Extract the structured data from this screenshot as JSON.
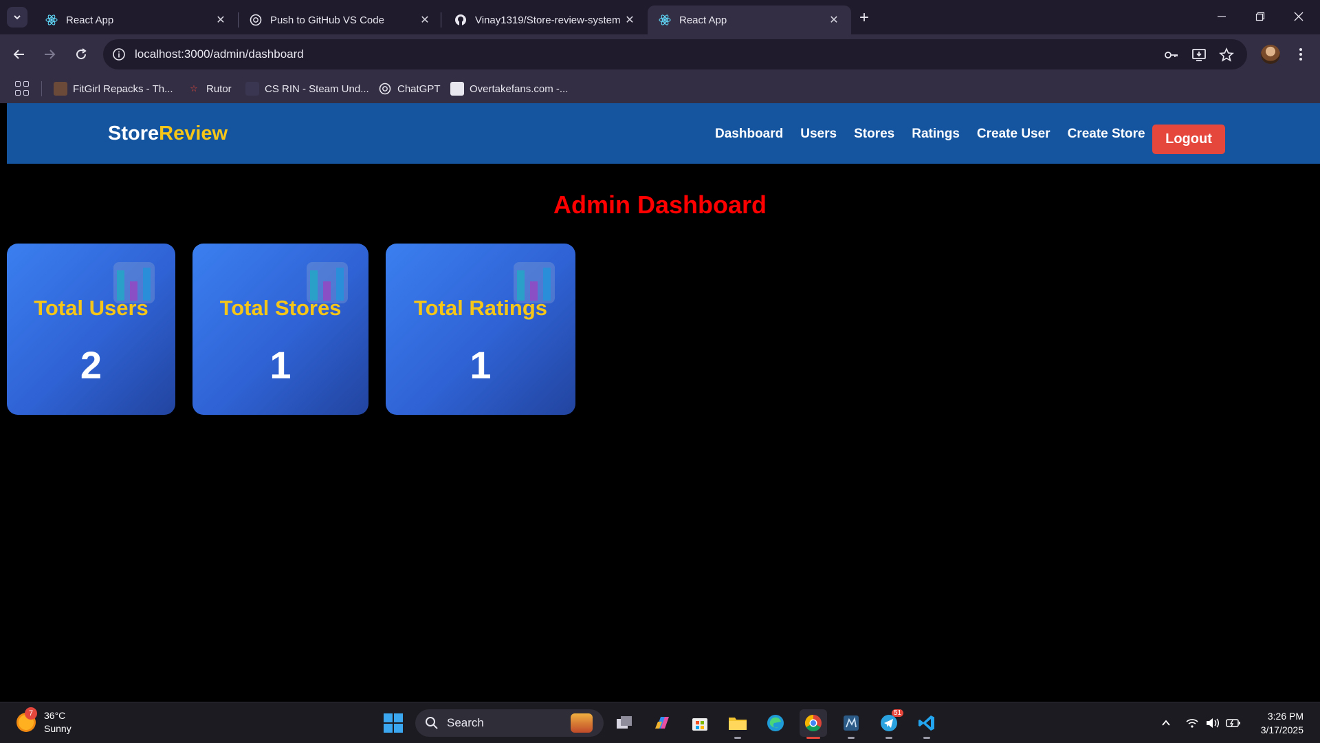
{
  "browser": {
    "tabs": [
      {
        "title": "React App",
        "icon": "react-icon",
        "active": false
      },
      {
        "title": "Push to GitHub VS Code",
        "icon": "chatgpt-icon",
        "active": false
      },
      {
        "title": "Vinay1319/Store-review-system",
        "icon": "github-icon",
        "active": false
      },
      {
        "title": "React App",
        "icon": "react-icon",
        "active": true
      }
    ],
    "url": "localhost:3000/admin/dashboard",
    "bookmarks": [
      {
        "label": "FitGirl Repacks - Th...",
        "icon": "fitgirl-icon"
      },
      {
        "label": "Rutor",
        "icon": "rutor-icon"
      },
      {
        "label": "CS RIN - Steam Und...",
        "icon": "csrin-icon"
      },
      {
        "label": "ChatGPT",
        "icon": "chatgpt-icon"
      },
      {
        "label": "Overtakefans.com -...",
        "icon": "overtakefans-icon"
      }
    ]
  },
  "app": {
    "brand_main": "Store",
    "brand_accent": "Review",
    "nav": [
      "Dashboard",
      "Users",
      "Stores",
      "Ratings",
      "Create User",
      "Create Store"
    ],
    "logout_label": "Logout",
    "page_title": "Admin Dashboard",
    "stats": [
      {
        "label": "Total Users",
        "value": "2"
      },
      {
        "label": "Total Stores",
        "value": "1"
      },
      {
        "label": "Total Ratings",
        "value": "1"
      }
    ],
    "colors": {
      "navbar": "#1555a0",
      "brand_accent": "#f5c518",
      "title": "#ff0000",
      "logout": "#e5473d",
      "card_label": "#f5c518"
    }
  },
  "taskbar": {
    "weather_temp": "36°C",
    "weather_desc": "Sunny",
    "weather_badge": "7",
    "search_label": "Search",
    "time": "3:26 PM",
    "date": "3/17/2025",
    "telegram_badge": "51"
  }
}
